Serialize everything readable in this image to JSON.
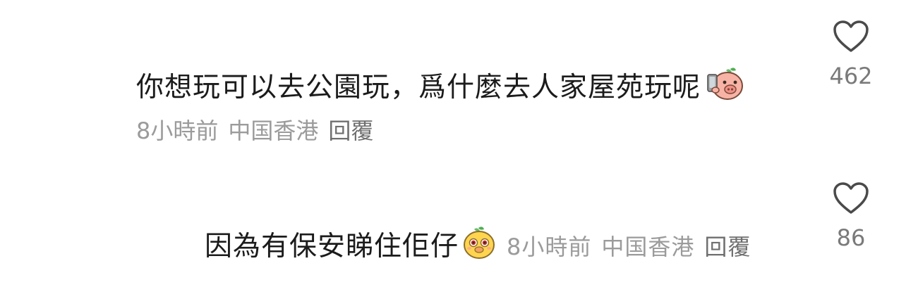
{
  "comments": [
    {
      "text": "你想玩可以去公園玩，爲什麼去人家屋苑玩呢",
      "emoji_icon": "pig-phone-emoji",
      "time": "8小時前",
      "location": "中国香港",
      "reply_label": "回覆",
      "like_count": "462"
    },
    {
      "text": "因為有保安睇住佢仔",
      "emoji_icon": "yellow-creature-emoji",
      "time": "8小時前",
      "location": "中国香港",
      "reply_label": "回覆",
      "like_count": "86"
    }
  ],
  "colors": {
    "text": "#1b1b1b",
    "meta": "#9b9b9b",
    "heart_stroke": "#4a4a4a"
  }
}
